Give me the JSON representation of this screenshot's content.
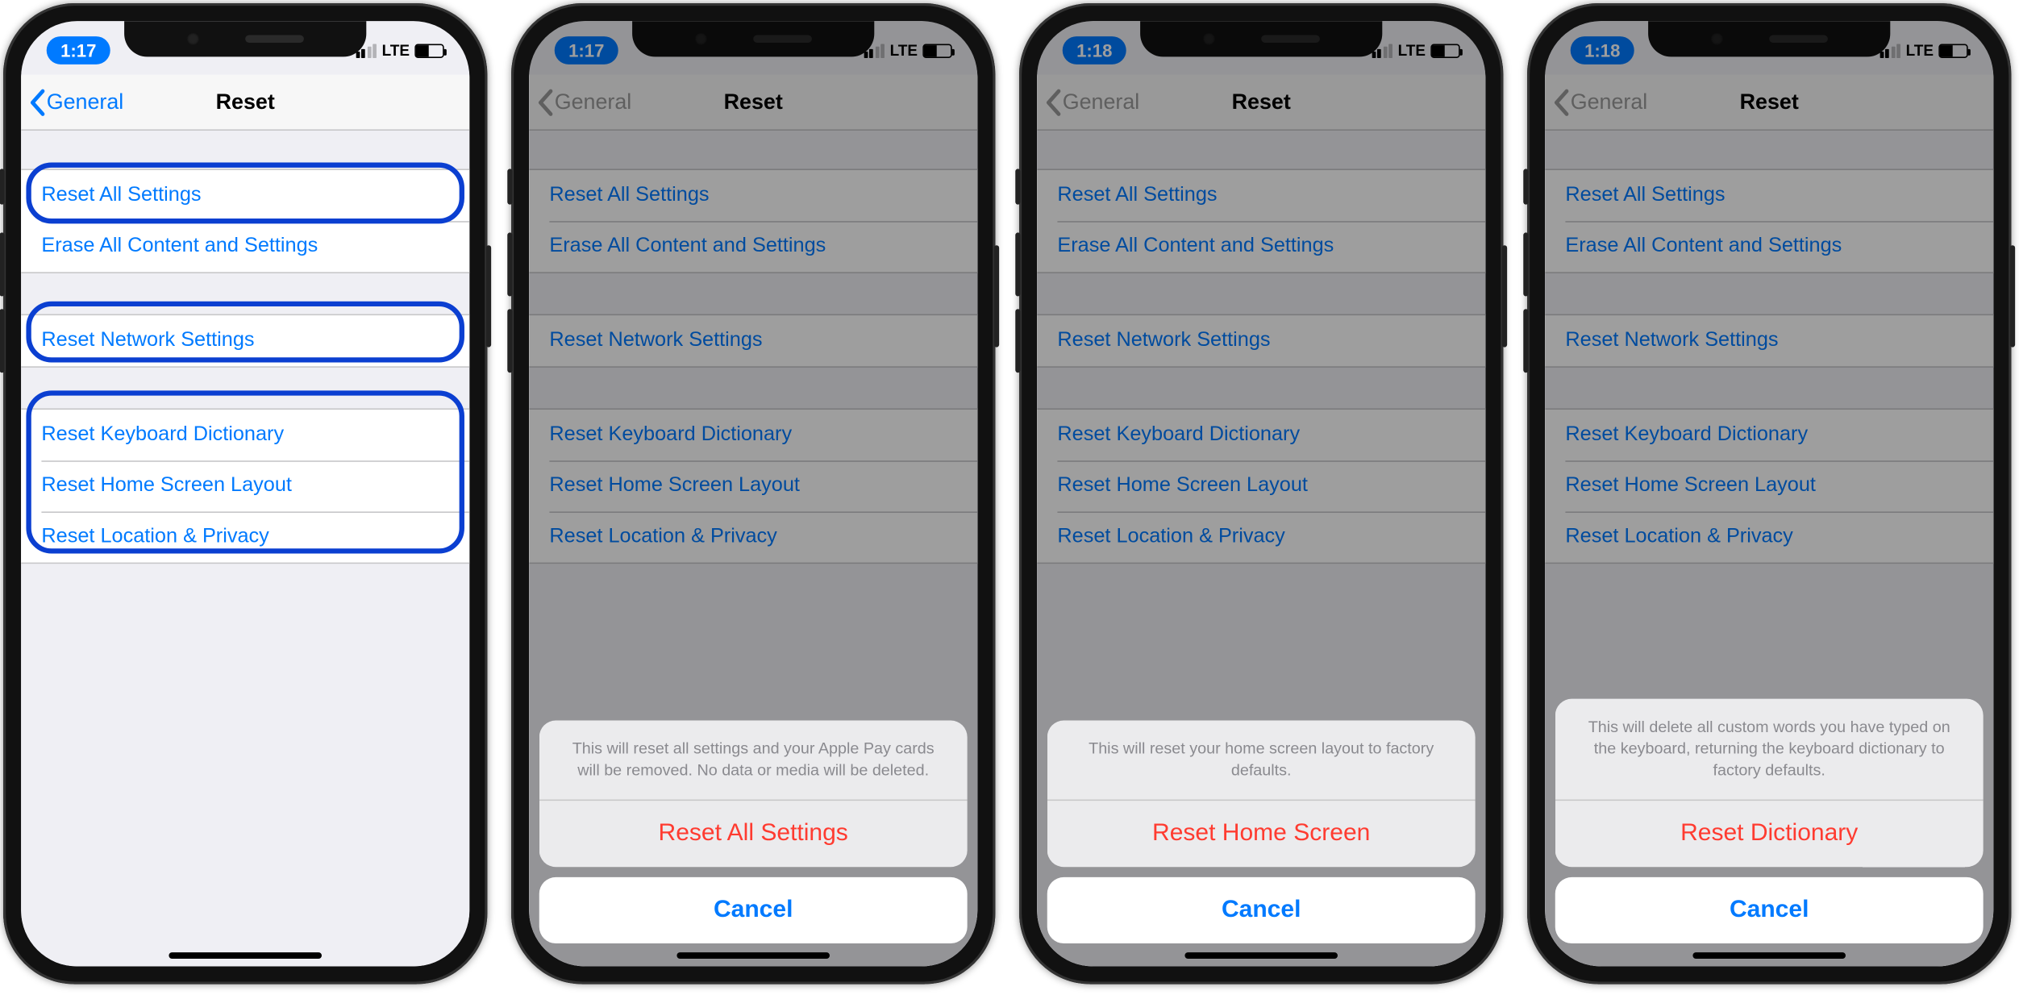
{
  "status": {
    "time_a": "1:17",
    "time_b": "1:18",
    "carrier": "LTE"
  },
  "nav": {
    "back": "General",
    "title": "Reset"
  },
  "rows": {
    "r1": "Reset All Settings",
    "r2": "Erase All Content and Settings",
    "r3": "Reset Network Settings",
    "r4": "Reset Keyboard Dictionary",
    "r5": "Reset Home Screen Layout",
    "r6": "Reset Location & Privacy"
  },
  "sheets": {
    "s1": {
      "msg": "This will reset all settings and your Apple Pay cards will be removed. No data or media will be deleted.",
      "action": "Reset All Settings"
    },
    "s2": {
      "msg": "This will reset your home screen layout to factory defaults.",
      "action": "Reset Home Screen"
    },
    "s3": {
      "msg": "This will delete all custom words you have typed on the keyboard, returning the keyboard dictionary to factory defaults.",
      "action": "Reset Dictionary"
    },
    "cancel": "Cancel"
  }
}
